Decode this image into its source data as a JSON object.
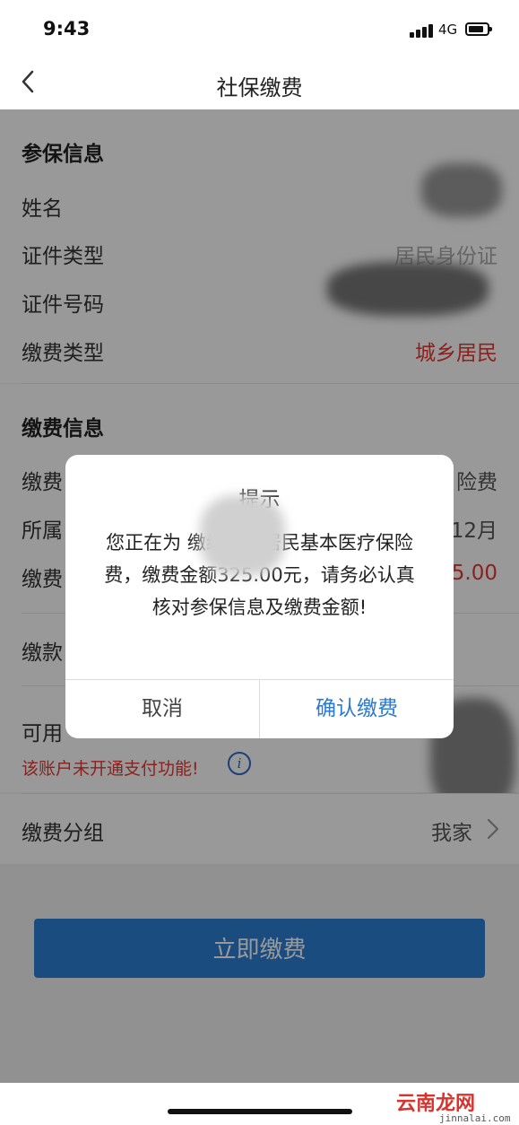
{
  "status": {
    "time": "9:43",
    "network": "4G"
  },
  "nav": {
    "title": "社保缴费"
  },
  "insured": {
    "section_title": "参保信息",
    "name_label": "姓名",
    "id_type_label": "证件类型",
    "id_type_value": "居民身份证",
    "id_number_label": "证件号码",
    "pay_type_label": "缴费类型",
    "pay_type_value": "城乡居民"
  },
  "payment": {
    "section_title": "缴费信息",
    "row1_label": "缴费",
    "row1_value": "险费",
    "row2_label": "所属",
    "row2_value": "12月",
    "row3_label": "缴费",
    "row3_value": "5.00",
    "row4_label": "缴款",
    "row5_label": "可用",
    "row5_value": "5",
    "warning": "该账户未开通支付功能!"
  },
  "group": {
    "label": "缴费分组",
    "value": "我家"
  },
  "pay_button": "立即缴费",
  "dialog": {
    "title": "提示",
    "message": "您正在为 缴纳城乡居民基本医疗保险费，缴费金额325.00元，请务必认真核对参保信息及缴费金额!",
    "cancel": "取消",
    "confirm": "确认缴费"
  },
  "watermark": {
    "text": "云南龙网",
    "sub": "jinnalai.com"
  },
  "colors": {
    "accent": "#2d7fd6",
    "warning": "#e53935",
    "link": "#2a7ad2"
  }
}
